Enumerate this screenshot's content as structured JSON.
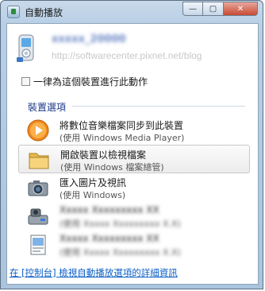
{
  "window": {
    "title": "自動播放",
    "min_symbol": "—",
    "max_symbol": "▢",
    "close_symbol": "✕"
  },
  "device": {
    "name": "xxxxx_20000",
    "watermark": "http://softwarecenter.pixnet.net/blog",
    "icon": "media-player-device-icon"
  },
  "always": {
    "label": "一律為這個裝置進行此動作"
  },
  "section": {
    "title": "裝置選項"
  },
  "options": [
    {
      "main": "將數位音樂檔案同步到此裝置",
      "sub": "(使用 Windows Media Player)",
      "icon": "windows-media-player-icon",
      "blurred": false
    },
    {
      "main": "開啟裝置以檢視檔案",
      "sub": "(使用 Windows 檔案總管)",
      "icon": "folder-icon",
      "blurred": false
    },
    {
      "main": "匯入圖片及視訊",
      "sub": "(使用 Windows)",
      "icon": "camera-icon",
      "blurred": false
    },
    {
      "main": "Xxxxx Xxxxxxxxx XX",
      "sub": "(使用 Xxxxx Xxxxxxxxx X.X)",
      "icon": "scanner-camera-icon",
      "blurred": true
    },
    {
      "main": "Xxxxx Xxxxxxxxx XX",
      "sub": "(使用 Xxxxx Xxxxxxxxx X.X)",
      "icon": "image-document-icon",
      "blurred": true
    }
  ],
  "footer": {
    "link": "在 [控制台] 檢視自動播放選項的詳細資訊"
  },
  "colors": {
    "link": "#0b5fc6",
    "section_title": "#1e3a8a",
    "frame": "#b8cfe6"
  }
}
